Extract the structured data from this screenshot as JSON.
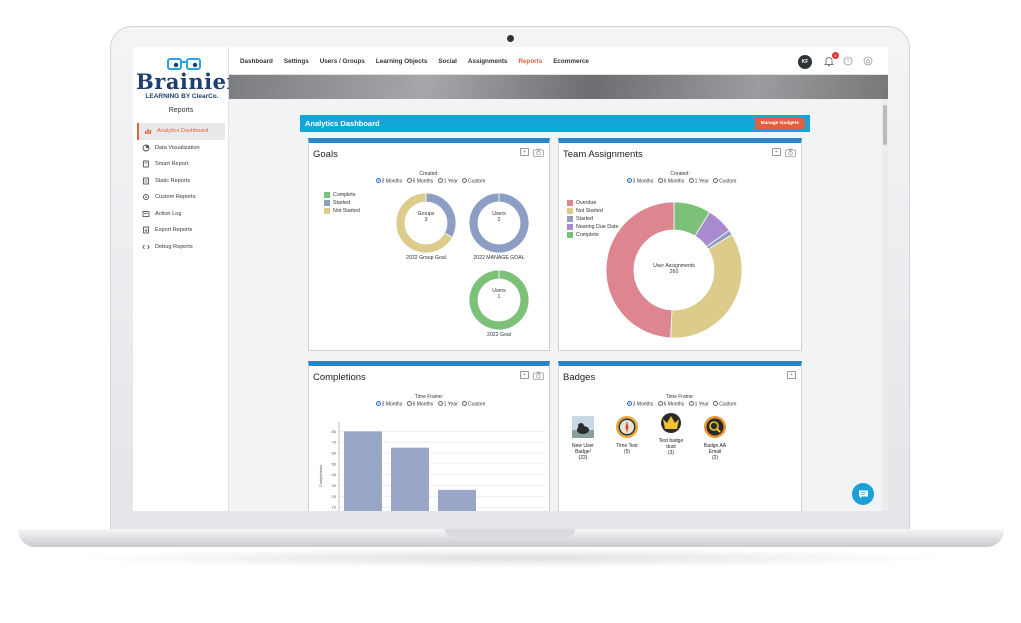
{
  "brand": {
    "name": "Brainier",
    "tagline": "LEARNING BY ClearCo."
  },
  "sidebar": {
    "title": "Reports",
    "items": [
      {
        "label": "Analytics Dashboard",
        "icon": "bar-chart-icon",
        "active": true
      },
      {
        "label": "Data Visualization",
        "icon": "pie-chart-icon"
      },
      {
        "label": "Smart Report",
        "icon": "smart-report-icon"
      },
      {
        "label": "Static Reports",
        "icon": "static-report-icon"
      },
      {
        "label": "Custom Reports",
        "icon": "custom-report-icon"
      },
      {
        "label": "Action Log",
        "icon": "action-log-icon"
      },
      {
        "label": "Export Reports",
        "icon": "export-icon"
      },
      {
        "label": "Debug Reports",
        "icon": "debug-icon"
      }
    ]
  },
  "nav": {
    "items": [
      "Dashboard",
      "Settings",
      "Users / Groups",
      "Learning Objects",
      "Social",
      "Assignments",
      "Reports",
      "Ecommerce"
    ],
    "active": "Reports",
    "avatar_initials": "KF",
    "notification_count": "6"
  },
  "dashboard": {
    "title": "Analytics Dashboard",
    "manage_label": "Manage Gadgets"
  },
  "filters": {
    "created_label": "Created:",
    "time_frame_label": "Time Frame:",
    "options": [
      "3 Months",
      "6 Months",
      "1 Year",
      "Custom"
    ],
    "selected": "3 Months"
  },
  "goals": {
    "title": "Goals",
    "legend": [
      {
        "label": "Complete",
        "color": "#7cc17a"
      },
      {
        "label": "Started",
        "color": "#8c9ec3"
      },
      {
        "label": "Not Started",
        "color": "#dccb8a"
      }
    ],
    "donuts": [
      {
        "center_title": "Groups",
        "center_value": "3",
        "caption": "2022 Group Goal",
        "segments": [
          {
            "status": "Started",
            "share": 0.33
          },
          {
            "status": "Not Started",
            "share": 0.67
          }
        ]
      },
      {
        "center_title": "Users",
        "center_value": "2",
        "caption": "2022 MANAGE GOAL",
        "segments": [
          {
            "status": "Started",
            "share": 1.0
          }
        ]
      },
      {
        "center_title": "Users",
        "center_value": "1",
        "caption": "2022 Goal",
        "segments": [
          {
            "status": "Complete",
            "share": 1.0
          }
        ]
      }
    ]
  },
  "team": {
    "title": "Team Assignments",
    "legend": [
      {
        "label": "Overdue",
        "color": "#dd8590"
      },
      {
        "label": "Not Started",
        "color": "#dccb8a"
      },
      {
        "label": "Started",
        "color": "#8c9ec3"
      },
      {
        "label": "Nearing Due Date",
        "color": "#a98ad0"
      },
      {
        "label": "Complete",
        "color": "#7cc17a"
      }
    ],
    "center_title": "User Assignments",
    "center_value": "260",
    "segments": [
      {
        "status": "Complete",
        "share": 0.088
      },
      {
        "status": "Nearing Due Date",
        "share": 0.063
      },
      {
        "status": "Started",
        "share": 0.012
      },
      {
        "status": "Not Started",
        "share": 0.345
      },
      {
        "status": "Overdue",
        "share": 0.492
      }
    ]
  },
  "completions": {
    "title": "Completions",
    "chart_data": {
      "type": "bar",
      "ylabel": "Completions",
      "yticks": [
        "0",
        "10",
        "20",
        "30",
        "40",
        "50",
        "60",
        "70",
        "80"
      ],
      "ylim": [
        0,
        85
      ],
      "values": [
        80,
        65,
        26
      ],
      "bar_color": "#9aa6c8"
    }
  },
  "badges": {
    "title": "Badges",
    "items": [
      {
        "name": "New User Badge!",
        "count": "(22)",
        "icon": "dog-photo-icon"
      },
      {
        "name": "Time Test",
        "count": "(5)",
        "icon": "compass-badge-icon"
      },
      {
        "name": "Test badge dust",
        "count": "(3)",
        "icon": "crown-badge-icon"
      },
      {
        "name": "Badge AA Email",
        "count": "(2)",
        "icon": "magnifier-badge-icon"
      }
    ]
  }
}
